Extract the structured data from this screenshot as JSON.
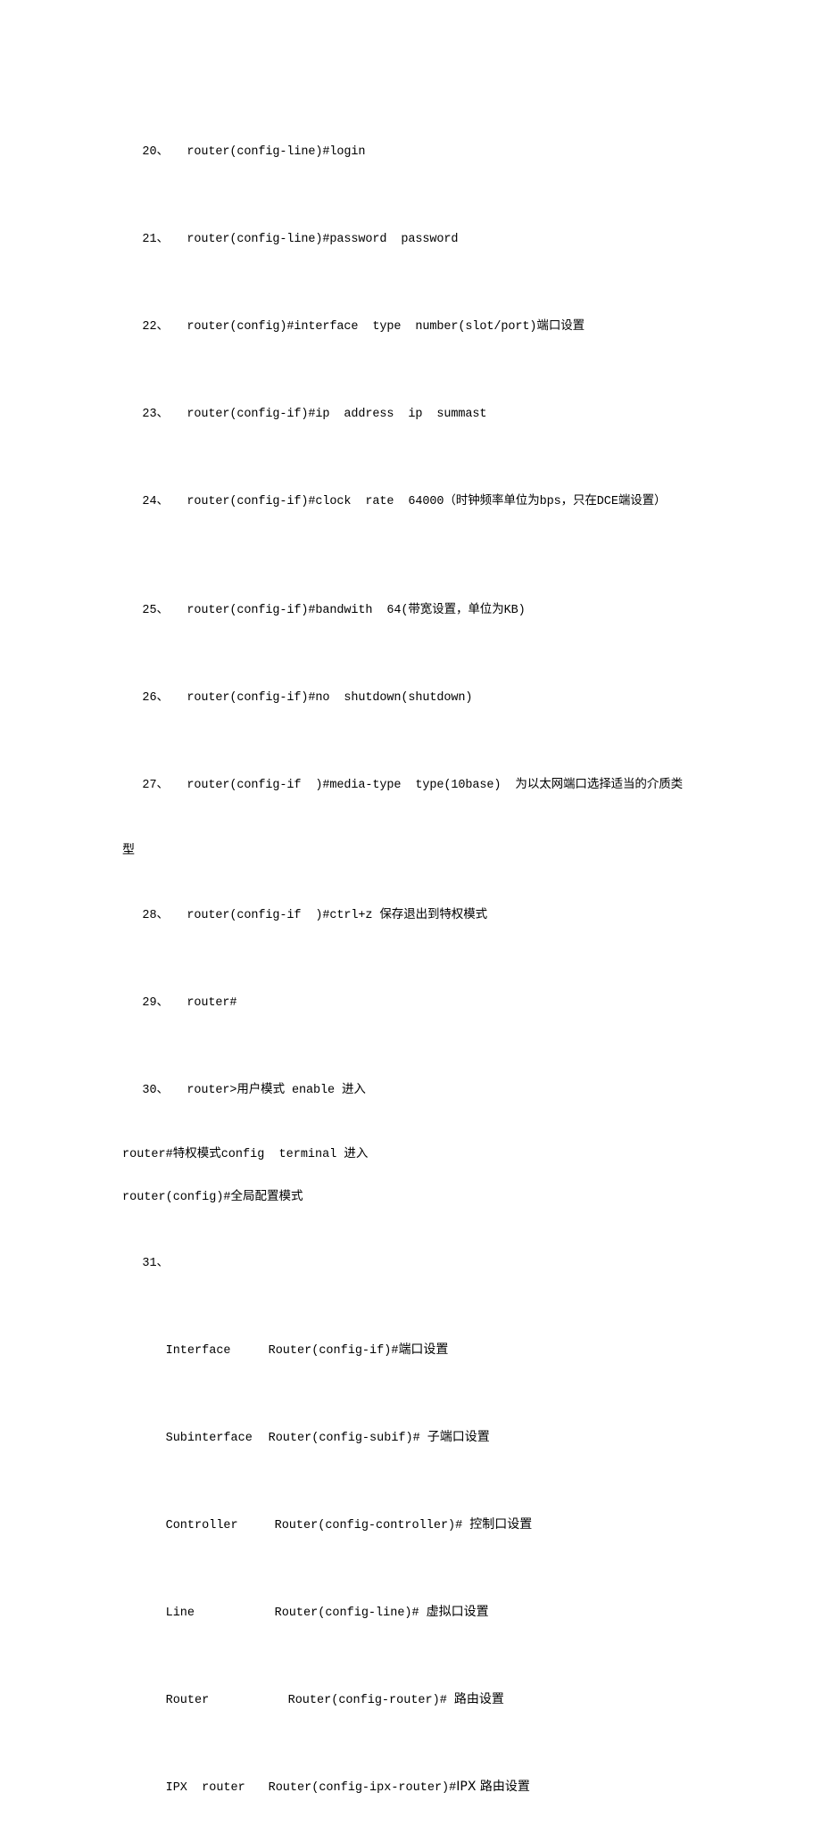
{
  "document": {
    "background_color": "#ffffff",
    "text_color": "#000000",
    "lines": [
      {
        "id": "item-20",
        "number": "20、",
        "body": "router(config-line)#login"
      },
      {
        "id": "item-21",
        "number": "21、",
        "body": "router(config-line)#password  password"
      },
      {
        "id": "item-22",
        "number": "22、",
        "body": "router(config)#interface  type  number(slot/port)端口设置"
      },
      {
        "id": "item-23",
        "number": "23、",
        "body": "router(config-if)#ip  address  ip  summast"
      },
      {
        "id": "item-24",
        "number": "24、",
        "body": "router(config-if)#clock  rate  64000（时钟频率单位为bps，只在DCE端设置）"
      },
      {
        "id": "item-25",
        "number": "25、",
        "body": "router(config-if)#bandwith  64(带宽设置，单位为KB)"
      },
      {
        "id": "item-26",
        "number": "26、",
        "body": "router(config-if)#no  shutdown(shutdown)"
      },
      {
        "id": "item-27",
        "number": "27、",
        "body": "router(config-if  )#media-type  type(10base)  为以太网端口选择适当的介质类"
      },
      {
        "id": "item-27-cont",
        "number": "",
        "body": "型"
      },
      {
        "id": "item-28",
        "number": "28、",
        "body": "router(config-if  )#ctrl+z 保存退出到特权模式"
      },
      {
        "id": "item-29",
        "number": "29、",
        "body": "router#"
      },
      {
        "id": "item-30",
        "number": "30、",
        "body": "router>用户模式 enable 进入"
      },
      {
        "id": "plain-1",
        "number": "",
        "body": "router#特权模式config  terminal 进入"
      },
      {
        "id": "plain-2",
        "number": "",
        "body": "router(config)#全局配置模式"
      },
      {
        "id": "item-31",
        "number": "31、",
        "body": ""
      }
    ],
    "item_27_wrap": "类",
    "item_27_wrap2": "型",
    "plain_lines": [
      "router#特权模式config  terminal 进入",
      "router(config)#全局配置模式"
    ],
    "mode_table": {
      "rows": [
        {
          "mode": "Interface",
          "prompt": "Router(config-if)#",
          "desc": "端口设置"
        },
        {
          "mode": "Subinterface",
          "prompt": "Router(config-subif)#",
          "desc": "子端口设置"
        },
        {
          "mode": "Controller",
          "prompt": "Router(config-controller)#",
          "desc": "控制口设置"
        },
        {
          "mode": "Line",
          "prompt": "Router(config-line)#",
          "desc": "虚拟口设置"
        },
        {
          "mode": "Router",
          "prompt": "Router(config-router)#",
          "desc": "路由设置"
        },
        {
          "mode": "IPX  router",
          "prompt": "Router(config-ipx-router)#",
          "desc": "IPX 路由设置"
        }
      ]
    }
  }
}
